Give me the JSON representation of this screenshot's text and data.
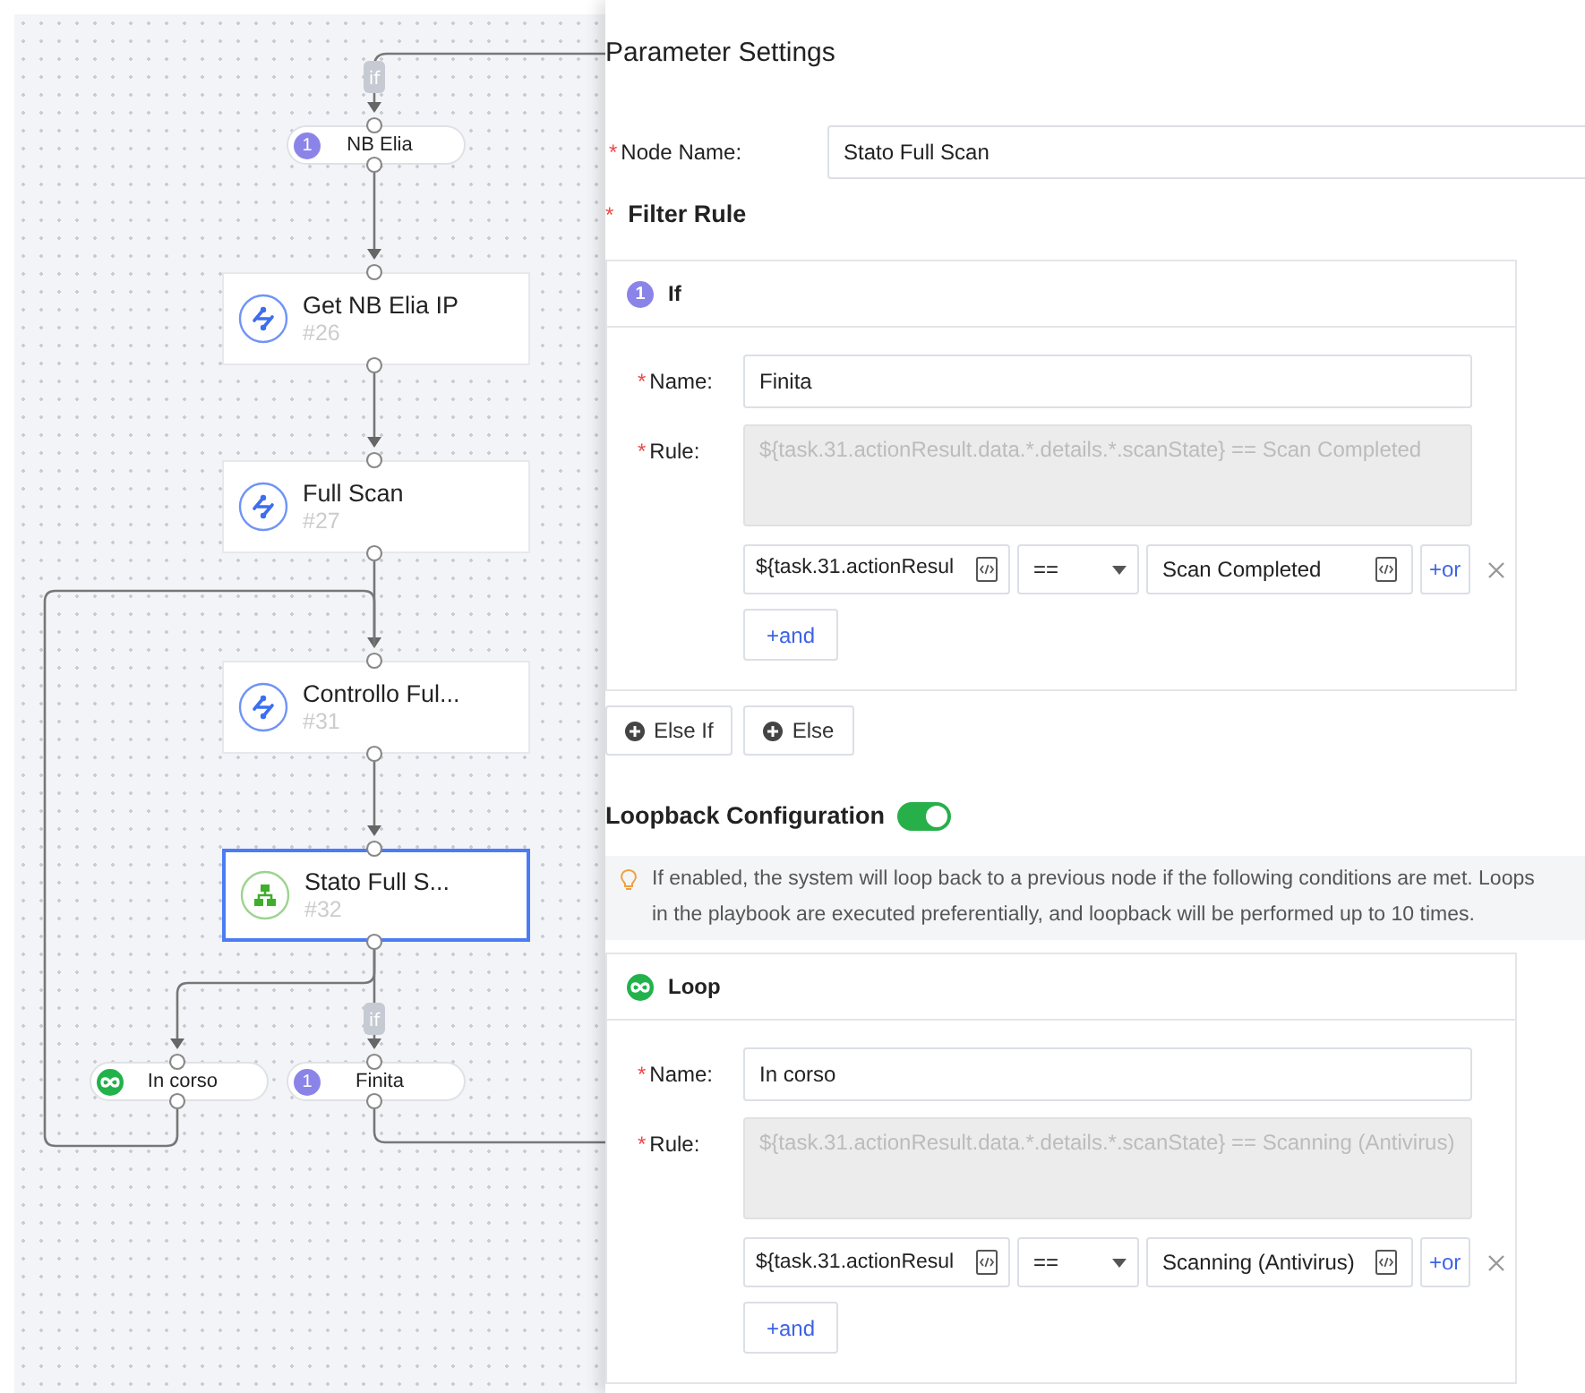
{
  "canvas": {
    "nodes": [
      {
        "kind": "condition",
        "badge": "1",
        "label": "NB Elia",
        "selected": false
      },
      {
        "kind": "action",
        "label": "Get NB Elia IP",
        "number": "#26",
        "selected": false
      },
      {
        "kind": "action",
        "label": "Full Scan",
        "number": "#27",
        "selected": false
      },
      {
        "kind": "action",
        "label": "Controllo Ful...",
        "number": "#31",
        "selected": false
      },
      {
        "kind": "decision",
        "label": "Stato Full S...",
        "number": "#32",
        "selected": true
      },
      {
        "kind": "loop",
        "label": "In corso",
        "selected": false
      },
      {
        "kind": "condition",
        "badge": "1",
        "label": "Finita",
        "selected": false
      }
    ],
    "edge_labels": [
      "if",
      "if"
    ]
  },
  "panel": {
    "title": "Parameter Settings",
    "node_name": {
      "required_mark": "*",
      "label": "Node Name:",
      "value": "Stato Full Scan"
    },
    "filter_rule": {
      "required_mark": "*",
      "title": "Filter Rule"
    },
    "branches": [
      {
        "kind": "if",
        "badge": "1",
        "title": "If",
        "name": {
          "required_mark": "*",
          "label": "Name:",
          "value": "Finita"
        },
        "rule": {
          "required_mark": "*",
          "label": "Rule:",
          "value": "${task.31.actionResult.data.*.details.*.scanState} == Scan Completed"
        },
        "condition": {
          "field": "${task.31.actionResul",
          "operator": "==",
          "value": "Scan Completed"
        },
        "or_button": "+or",
        "and_button": "+and"
      }
    ],
    "add_buttons": [
      "Else If",
      "Else"
    ],
    "loopback": {
      "title": "Loopback Configuration",
      "on": true,
      "info_lines": [
        "If enabled, the system will loop back to a previous node if the following conditions are met. Loops",
        "in the playbook are executed preferentially, and loopback will be performed up to 10 times."
      ]
    },
    "loops": [
      {
        "kind": "loop",
        "title": "Loop",
        "name": {
          "required_mark": "*",
          "label": "Name:",
          "value": "In corso"
        },
        "rule": {
          "required_mark": "*",
          "label": "Rule:",
          "value": "${task.31.actionResult.data.*.details.*.scanState} == Scanning (Antivirus)"
        },
        "condition": {
          "field": "${task.31.actionResul",
          "operator": "==",
          "value": "Scanning (Antivirus)"
        },
        "or_button": "+or",
        "and_button": "+and"
      }
    ]
  }
}
